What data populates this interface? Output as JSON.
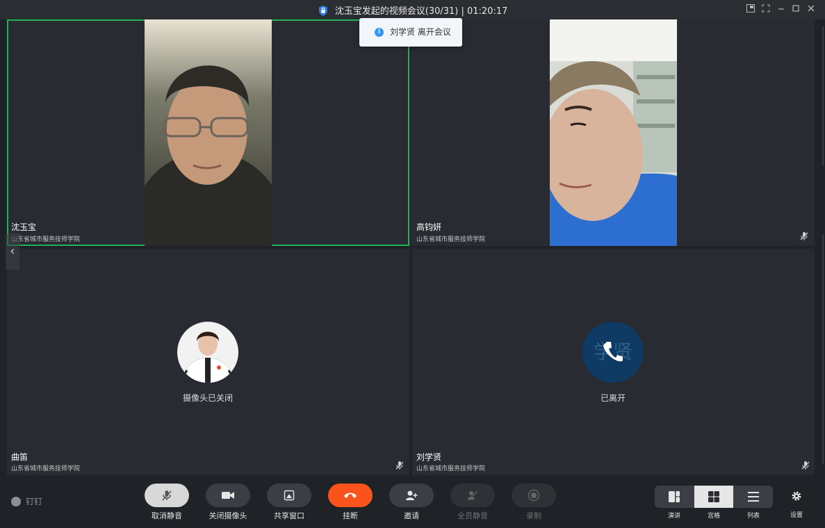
{
  "window": {
    "title": "沈玉宝发起的视频会议(30/31) | 01:20:17",
    "controls": [
      "pip-icon",
      "fullscreen-icon",
      "minimize-icon",
      "maximize-icon",
      "close-icon"
    ]
  },
  "toast": {
    "icon": "info-icon",
    "message": "刘学贤 离开会议"
  },
  "participants": [
    {
      "name": "沈玉宝",
      "org": "山东省城市服务技师学院",
      "state": "video",
      "active_speaker": true
    },
    {
      "name": "高钧妍",
      "org": "山东省城市服务技师学院",
      "state": "video",
      "muted": true
    },
    {
      "name": "曲笛",
      "org": "山东省城市服务技师学院",
      "state": "camera_off",
      "caption": "摄像头已关闭",
      "muted": true
    },
    {
      "name": "刘学贤",
      "org": "山东省城市服务技师学院",
      "state": "left",
      "caption": "已离开",
      "avatar_text": "学贤",
      "muted": true
    }
  ],
  "brand": {
    "label": "钉钉"
  },
  "toolbar": {
    "unmute": "取消静音",
    "camera_off": "关闭摄像头",
    "share": "共享窗口",
    "hangup": "挂断",
    "invite": "邀请",
    "mute_all": "全员静音",
    "record": "录制"
  },
  "layout_modes": [
    {
      "label": "演讲",
      "icon": "speaker-layout-icon",
      "selected": false
    },
    {
      "label": "宫格",
      "icon": "grid-layout-icon",
      "selected": true
    },
    {
      "label": "列表",
      "icon": "list-layout-icon",
      "selected": false
    }
  ],
  "settings": {
    "label": "设置"
  },
  "colors": {
    "active_border": "#1fb356",
    "hangup": "#fa541c",
    "toast_info": "#3296fa",
    "left_avatar": "#0e3a63"
  }
}
